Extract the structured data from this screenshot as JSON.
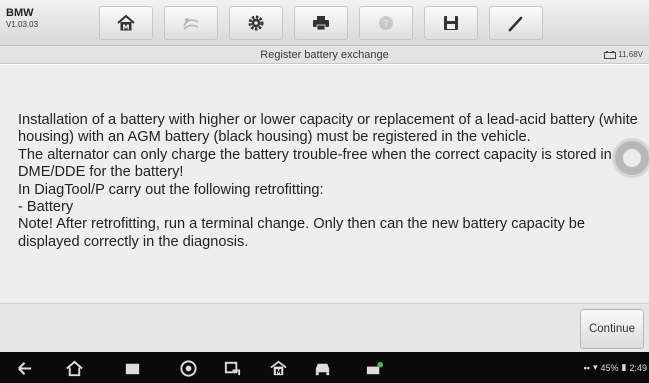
{
  "app": {
    "brand": "BMW",
    "version": "V1.03.03"
  },
  "toolbar": {
    "buttons": [
      {
        "icon": "home-icon",
        "enabled": true
      },
      {
        "icon": "vehicle-swap-icon",
        "enabled": false
      },
      {
        "icon": "gear-icon",
        "enabled": true
      },
      {
        "icon": "printer-icon",
        "enabled": true
      },
      {
        "icon": "help-icon",
        "enabled": false
      },
      {
        "icon": "save-icon",
        "enabled": true
      },
      {
        "icon": "pen-icon",
        "enabled": true
      }
    ]
  },
  "title_bar": {
    "title": "Register battery exchange",
    "battery_voltage": "11.68V"
  },
  "message": {
    "paragraphs": [
      "Installation of a battery with higher or lower capacity or replacement of a lead-acid battery (white housing) with an AGM battery (black housing) must be registered in the vehicle.",
      "The alternator can only charge the battery trouble-free when the correct capacity is stored in the DME/DDE for the battery!",
      "In DiagTool/P carry out the following retrofitting:",
      "- Battery",
      "Note! After retrofitting, run a terminal change. Only then can the new battery capacity be displayed correctly in the diagnosis."
    ]
  },
  "actions": {
    "continue_label": "Continue"
  },
  "nav_bar": {
    "icons": [
      "back-icon",
      "home-icon",
      "recent-apps-icon",
      "browser-icon",
      "screenshot-icon",
      "app-home-icon",
      "car-icon",
      "vci-icon"
    ],
    "status": {
      "battery_percent": "45%",
      "time": "2:49"
    }
  },
  "colors": {
    "toolbar_bg": "#e2e2e2",
    "content_bg": "#eeeeee",
    "nav_bg": "#0a0a0a"
  }
}
